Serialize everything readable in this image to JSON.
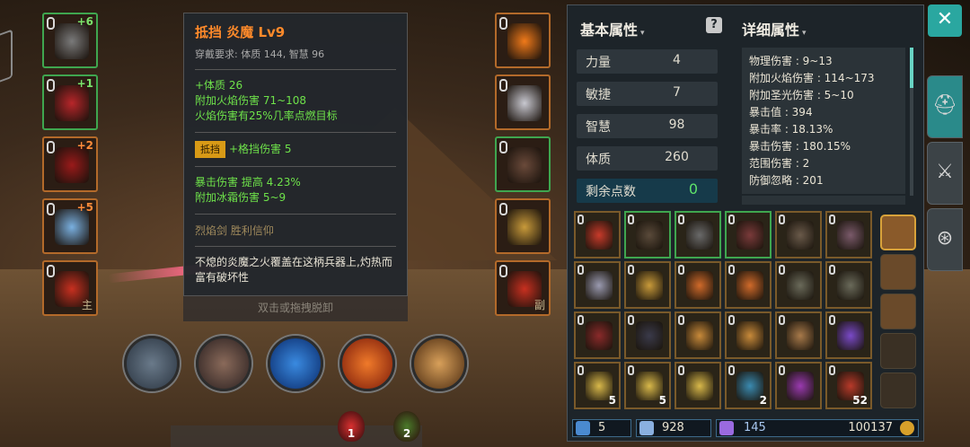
{
  "tooltip": {
    "title": "抵挡 炎魔 Lv9",
    "requirement": "穿戴要求:  体质 144, 智慧 96",
    "bonuses": [
      "+体质 26",
      "附加火焰伤害 71~108",
      "火焰伤害有25%几率点燃目标"
    ],
    "block_tag": "抵挡",
    "block_bonus": "+格挡伤害 5",
    "extra_bonuses": [
      "暴击伤害 提高 4.23%",
      "附加冰霜伤害 5~9"
    ],
    "set_line": "烈焰剑    胜利信仰",
    "description": "不熄的炎魔之火覆盖在这柄兵器上,灼热而富有破坏性",
    "footer": "双击或拖拽脱卸"
  },
  "left_slots": [
    {
      "plus": "+6",
      "tag": "",
      "color": "green",
      "art": "#7a7a7a"
    },
    {
      "plus": "+1",
      "tag": "",
      "color": "green",
      "art": "#b8262a"
    },
    {
      "plus": "+2",
      "tag": "",
      "color": "orange",
      "art": "#9a1a1a"
    },
    {
      "plus": "+5",
      "tag": "",
      "color": "orange",
      "art": "#7ab0e0"
    },
    {
      "plus": "",
      "tag": "主",
      "color": "orange",
      "art": "#c83020"
    }
  ],
  "right_slots": [
    {
      "plus": "",
      "tag": "",
      "color": "orange",
      "art": "#f07a1a"
    },
    {
      "plus": "",
      "tag": "",
      "color": "orange",
      "art": "#c8c8d0"
    },
    {
      "plus": "",
      "tag": "",
      "color": "green",
      "art": "#6a4a3a"
    },
    {
      "plus": "",
      "tag": "",
      "color": "orange",
      "art": "#c89a3a"
    },
    {
      "plus": "",
      "tag": "副",
      "color": "orange",
      "art": "#c83020"
    }
  ],
  "potions": [
    {
      "count": "1",
      "color": "#d83030"
    },
    {
      "count": "2",
      "color": "#4a7a2a"
    }
  ],
  "panel": {
    "basic_title": "基本属性",
    "detail_title": "详细属性",
    "help": "?",
    "stats": [
      {
        "name": "力量",
        "value": "4"
      },
      {
        "name": "敏捷",
        "value": "7"
      },
      {
        "name": "智慧",
        "value": "98"
      },
      {
        "name": "体质",
        "value": "260"
      }
    ],
    "remaining": {
      "name": "剩余点数",
      "value": "0"
    },
    "details": [
      "物理伤害 : 9~13",
      "附加火焰伤害 : 114~173",
      "附加圣光伤害 : 5~10",
      "暴击值 : 394",
      "暴击率 : 18.13%",
      "暴击伤害 : 180.15%",
      "范围伤害 : 2",
      "防御忽略 : 201"
    ]
  },
  "inventory": [
    [
      {
        "c": "#c83a2a",
        "n": ""
      },
      {
        "c": "#5a4a3a",
        "n": "",
        "g": 1
      },
      {
        "c": "#6a6a6a",
        "n": "",
        "g": 1
      },
      {
        "c": "#7a3a3a",
        "n": "",
        "g": 1
      },
      {
        "c": "#6a5a4a",
        "n": ""
      },
      {
        "c": "#7a5a6a",
        "n": ""
      }
    ],
    [
      {
        "c": "#9a9ab0",
        "n": ""
      },
      {
        "c": "#c89a3a",
        "n": ""
      },
      {
        "c": "#d06a2a",
        "n": ""
      },
      {
        "c": "#d06a2a",
        "n": ""
      },
      {
        "c": "#6a6a5a",
        "n": ""
      },
      {
        "c": "#6a6a5a",
        "n": ""
      }
    ],
    [
      {
        "c": "#8a2a2a",
        "n": ""
      },
      {
        "c": "#3a3a4a",
        "n": ""
      },
      {
        "c": "#c88a3a",
        "n": ""
      },
      {
        "c": "#c88a3a",
        "n": ""
      },
      {
        "c": "#a87a4a",
        "n": ""
      },
      {
        "c": "#7a4ac8",
        "n": ""
      }
    ],
    [
      {
        "c": "#d8b84a",
        "n": "5"
      },
      {
        "c": "#d8b84a",
        "n": "5"
      },
      {
        "c": "#d8b84a",
        "n": ""
      },
      {
        "c": "#3a8ab0",
        "n": "2"
      },
      {
        "c": "#9a3ab0",
        "n": ""
      },
      {
        "c": "#b83a2a",
        "n": "52"
      }
    ]
  ],
  "currency": {
    "gems": "5",
    "souls": "928",
    "crystals": "145",
    "gold": "100137"
  },
  "close_label": "✕",
  "tabs": [
    {
      "glyph": "⛑"
    },
    {
      "glyph": "⚔"
    },
    {
      "glyph": "⊛"
    }
  ]
}
